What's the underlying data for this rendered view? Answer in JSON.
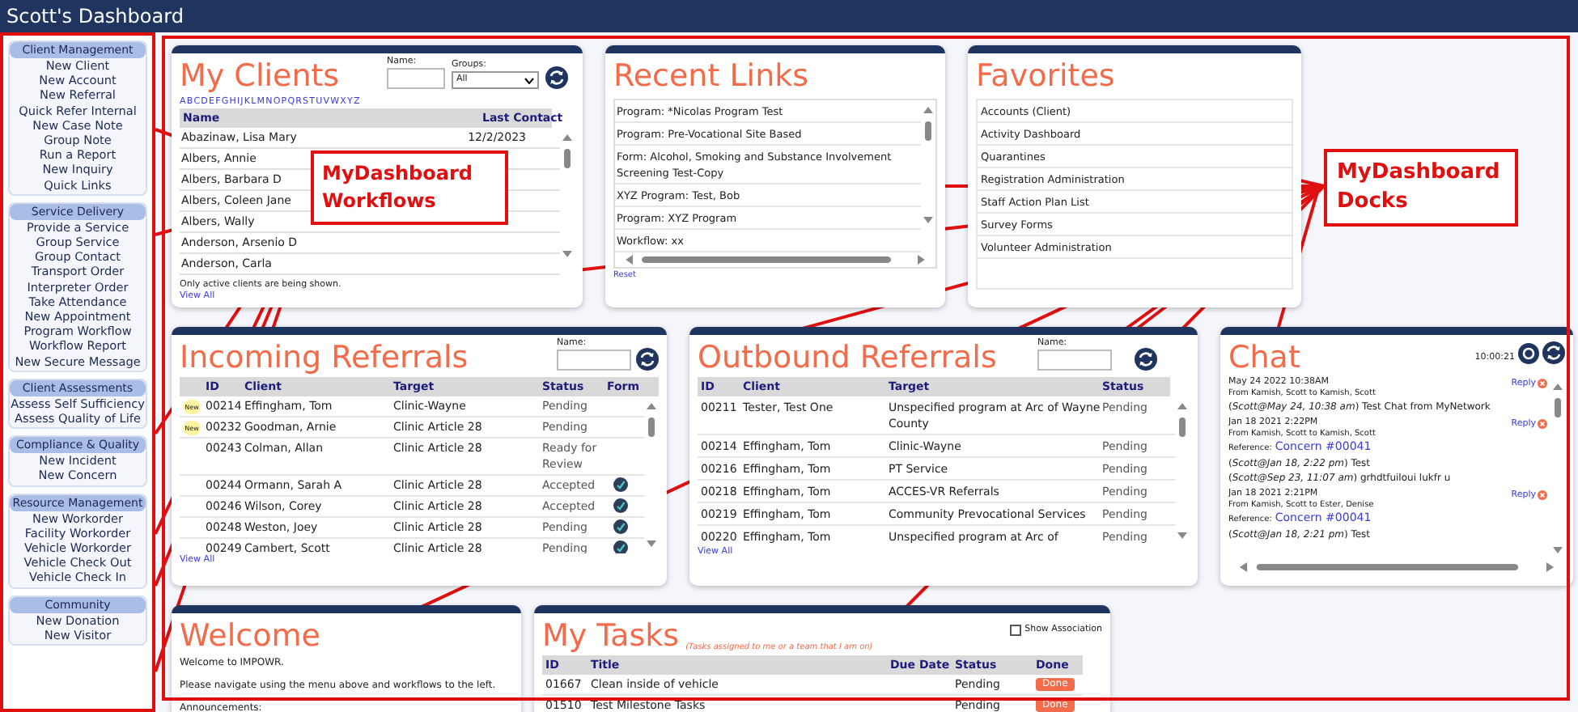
{
  "window": {
    "title": "Scott's Dashboard"
  },
  "sidebar": {
    "sections": [
      {
        "title": "Client Management",
        "items": [
          "New Client",
          "New Account",
          "New Referral",
          "Quick Refer Internal",
          "New Case Note",
          "Group Note",
          "Run a Report",
          "New Inquiry",
          "Quick Links"
        ]
      },
      {
        "title": "Service Delivery",
        "items": [
          "Provide a Service",
          "Group Service",
          "Group Contact",
          "Transport Order",
          "Interpreter Order",
          "Take Attendance",
          "New Appointment",
          "Program Workflow",
          "Workflow Report",
          "New Secure Message"
        ]
      },
      {
        "title": "Client Assessments",
        "items": [
          "Assess Self Sufficiency",
          "Assess Quality of Life"
        ]
      },
      {
        "title": "Compliance & Quality",
        "items": [
          "New Incident",
          "New Concern"
        ]
      },
      {
        "title": "Resource Management",
        "items": [
          "New Workorder",
          "Facility Workorder",
          "Vehicle Workorder",
          "Vehicle Check Out",
          "Vehicle Check In"
        ]
      },
      {
        "title": "Community",
        "items": [
          "New Donation",
          "New Visitor"
        ]
      }
    ]
  },
  "my_clients": {
    "title": "My Clients",
    "name_label": "Name:",
    "groups_label": "Groups:",
    "groups_value": "All",
    "letters": [
      "A",
      "B",
      "C",
      "D",
      "E",
      "F",
      "G",
      "H",
      "I",
      "J",
      "K",
      "L",
      "M",
      "N",
      "O",
      "P",
      "Q",
      "R",
      "S",
      "T",
      "U",
      "V",
      "W",
      "X",
      "Y",
      "Z"
    ],
    "columns": [
      "Name",
      "Last Contact"
    ],
    "rows": [
      {
        "name": "Abazinaw, Lisa Mary",
        "last_contact": "12/2/2023"
      },
      {
        "name": "Albers, Annie"
      },
      {
        "name": "Albers, Barbara D"
      },
      {
        "name": "Albers, Coleen Jane"
      },
      {
        "name": "Albers, Wally"
      },
      {
        "name": "Anderson, Arsenio D"
      },
      {
        "name": "Anderson, Carla"
      }
    ],
    "note": "Only active clients are being shown.",
    "view_all": "View All"
  },
  "recent_links": {
    "title": "Recent Links",
    "items": [
      "Program: *Nicolas Program Test",
      "Program: Pre-Vocational Site Based",
      "Form: Alcohol, Smoking and Substance Involvement Screening Test-Copy",
      "XYZ Program: Test, Bob",
      "Program: XYZ Program",
      "Workflow: xx"
    ],
    "reset": "Reset"
  },
  "favorites": {
    "title": "Favorites",
    "items": [
      "Accounts (Client)",
      "Activity Dashboard",
      "Quarantines",
      "Registration Administration",
      "Staff Action Plan List",
      "Survey Forms",
      "Volunteer Administration"
    ]
  },
  "incoming_referrals": {
    "title": "Incoming Referrals",
    "name_label": "Name:",
    "columns": [
      "ID",
      "Client",
      "Target",
      "Status",
      "Form"
    ],
    "rows": [
      {
        "badge": "New",
        "id": "00214",
        "client": "Effingham, Tom",
        "target": "Clinic-Wayne",
        "status": "Pending",
        "has_form": false
      },
      {
        "badge": "New",
        "id": "00232",
        "client": "Goodman, Arnie",
        "target": "Clinic Article 28",
        "status": "Pending",
        "has_form": false
      },
      {
        "id": "00243",
        "client": "Colman, Allan",
        "target": "Clinic Article 28",
        "status": "Ready for Review",
        "has_form": false
      },
      {
        "id": "00244",
        "client": "Ormann, Sarah A",
        "target": "Clinic Article 28",
        "status": "Accepted",
        "has_form": true
      },
      {
        "id": "00246",
        "client": "Wilson, Corey",
        "target": "Clinic Article 28",
        "status": "Accepted",
        "has_form": true
      },
      {
        "id": "00248",
        "client": "Weston, Joey",
        "target": "Clinic Article 28",
        "status": "Pending",
        "has_form": true
      },
      {
        "id": "00249",
        "client": "Cambert, Scott",
        "target": "Clinic Article 28",
        "status": "Pending",
        "has_form": true
      }
    ],
    "view_all": "View All"
  },
  "outbound_referrals": {
    "title": "Outbound Referrals",
    "name_label": "Name:",
    "columns": [
      "ID",
      "Client",
      "Target",
      "Status"
    ],
    "rows": [
      {
        "id": "00211",
        "client": "Tester, Test One",
        "target": "Unspecified program at Arc of Wayne County",
        "status": "Pending"
      },
      {
        "id": "00214",
        "client": "Effingham, Tom",
        "target": "Clinic-Wayne",
        "status": "Pending"
      },
      {
        "id": "00216",
        "client": "Effingham, Tom",
        "target": "PT Service",
        "status": "Pending"
      },
      {
        "id": "00218",
        "client": "Effingham, Tom",
        "target": "ACCES-VR Referrals",
        "status": "Pending"
      },
      {
        "id": "00219",
        "client": "Effingham, Tom",
        "target": "Community Prevocational Services",
        "status": "Pending"
      },
      {
        "id": "00220",
        "client": "Effingham, Tom",
        "target": "Unspecified program at Arc of",
        "status": "Pending"
      }
    ],
    "view_all": "View All"
  },
  "chat": {
    "title": "Chat",
    "time": "10:00:21",
    "messages": [
      {
        "date": "May 24 2022 10:38AM",
        "from": "From Kamish, Scott to Kamish, Scott",
        "reply": "Reply",
        "entries": [
          "(*Scott@May 24, 10:38 am*) Test Chat from MyNetwork"
        ]
      },
      {
        "date": "Jan 18 2021 2:22PM",
        "from": "From Kamish, Scott to Kamish, Scott",
        "reply": "Reply",
        "reference_label": "Reference:",
        "reference": "Concern #00041",
        "entries": [
          "(*Scott@Jan 18, 2:22 pm*) Test",
          "(*Scott@Sep 23, 11:07 am*) grhdtfuiloui lukfr u"
        ]
      },
      {
        "date": "Jan 18 2021 2:21PM",
        "from": "From Kamish, Scott to Ester, Denise",
        "reply": "Reply",
        "reference_label": "Reference:",
        "reference": "Concern #00041",
        "entries": [
          "(*Scott@Jan 18, 2:21 pm*) Test"
        ]
      }
    ]
  },
  "welcome": {
    "title": "Welcome",
    "lines": [
      "Welcome to IMPOWR.",
      "Please navigate using the menu above and workflows to the left.",
      "Announcements:"
    ]
  },
  "my_tasks": {
    "title": "My Tasks",
    "subtitle": "(Tasks assigned to me or a team that I am on)",
    "show_association": {
      "label": "Show Association",
      "checked": false
    },
    "columns": [
      "ID",
      "Title",
      "Due Date",
      "Status",
      "Done"
    ],
    "rows": [
      {
        "id": "01667",
        "title": "Clean inside of vehicle",
        "status": "Pending",
        "done": "Done"
      },
      {
        "id": "01510",
        "title": "Test Milestone Tasks",
        "status": "Pending",
        "done": "Done"
      }
    ]
  },
  "annotations": [
    {
      "text": "MyDashboard Workflows"
    },
    {
      "text": "MyDashboard Docks"
    }
  ]
}
